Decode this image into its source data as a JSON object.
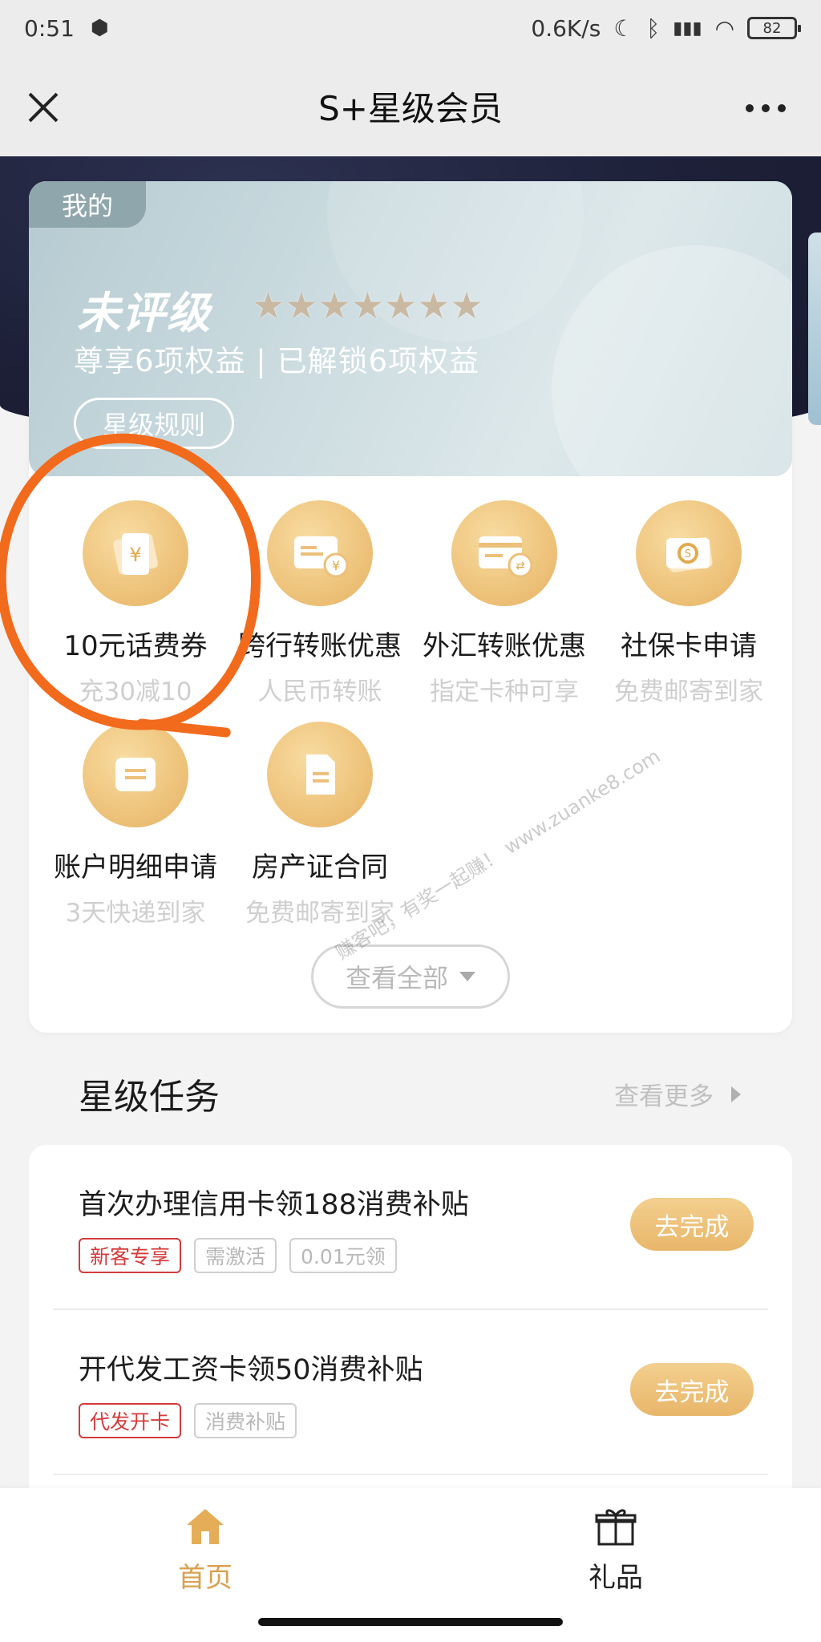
{
  "status_bar": {
    "time": "0:51",
    "network_speed": "0.6K/s",
    "battery": "82"
  },
  "nav": {
    "title": "S+星级会员"
  },
  "member_card": {
    "tag": "我的",
    "level": "未评级",
    "stars": "★★★★★★★",
    "benefits_text": "尊享6项权益 | 已解锁6项权益",
    "rules_button": "星级规则"
  },
  "benefits": [
    {
      "title": "10元话费券",
      "subtitle": "充30减10",
      "icon": "voucher-icon"
    },
    {
      "title": "跨行转账优惠",
      "subtitle": "人民币转账",
      "icon": "card-yuan-icon"
    },
    {
      "title": "外汇转账优惠",
      "subtitle": "指定卡种可享",
      "icon": "card-exchange-icon"
    },
    {
      "title": "社保卡申请",
      "subtitle": "免费邮寄到家",
      "icon": "social-security-card-icon"
    },
    {
      "title": "账户明细申请",
      "subtitle": "3天快递到家",
      "icon": "message-icon"
    },
    {
      "title": "房产证合同",
      "subtitle": "免费邮寄到家",
      "icon": "document-icon"
    }
  ],
  "view_all_button": "查看全部",
  "tasks_section": {
    "title": "星级任务",
    "more": "查看更多"
  },
  "tasks": [
    {
      "title": "首次办理信用卡领188消费补贴",
      "tags": [
        "新客专享",
        "需激活",
        "0.01元领"
      ],
      "button": "去完成"
    },
    {
      "title": "开代发工资卡领50消费补贴",
      "tags": [
        "代发开卡",
        "消费补贴"
      ],
      "button": "去完成"
    }
  ],
  "tab_bar": {
    "home": "首页",
    "gifts": "礼品"
  },
  "colors": {
    "accent_gold": "#e8b66a",
    "active_tab": "#d9a04f",
    "tag_red": "#d43b3b",
    "annotation": "#f26a1c"
  },
  "watermark": "赚客吧，有奖一起赚！ www.zuanke8.com"
}
